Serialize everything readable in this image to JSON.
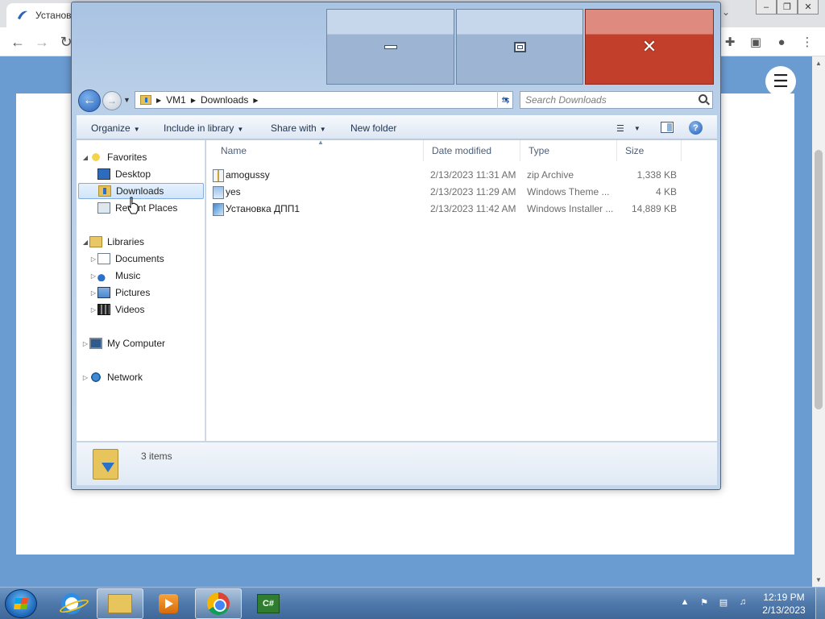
{
  "browser": {
    "tab_title": "Установ",
    "toolbar_icons": [
      "back-icon",
      "forward-icon",
      "reload-icon",
      "extensions-icon",
      "side-panel-icon",
      "profile-icon",
      "menu-icon"
    ],
    "accent_color": "#6a9bd1"
  },
  "explorer": {
    "breadcrumbs": [
      "VM1",
      "Downloads"
    ],
    "search_placeholder": "Search Downloads",
    "commands": {
      "organize": "Organize",
      "include_in_library": "Include in library",
      "share_with": "Share with",
      "new_folder": "New folder"
    },
    "nav": {
      "favorites": "Favorites",
      "desktop": "Desktop",
      "downloads": "Downloads",
      "recent_places": "Recent Places",
      "libraries": "Libraries",
      "documents": "Documents",
      "music": "Music",
      "pictures": "Pictures",
      "videos": "Videos",
      "my_computer": "My Computer",
      "network": "Network"
    },
    "columns": {
      "name": "Name",
      "date_modified": "Date modified",
      "type": "Type",
      "size": "Size"
    },
    "files": [
      {
        "name": "amogussy",
        "date": "2/13/2023 11:31 AM",
        "type": "zip Archive",
        "size": "1,338 KB",
        "icon": "zip-icon"
      },
      {
        "name": "yes",
        "date": "2/13/2023 11:29 AM",
        "type": "Windows Theme ...",
        "size": "4 KB",
        "icon": "theme-file-icon"
      },
      {
        "name": "Установка ДПП1",
        "date": "2/13/2023 11:42 AM",
        "type": "Windows Installer ...",
        "size": "14,889 KB",
        "icon": "installer-icon"
      }
    ],
    "item_count": "3 items"
  },
  "taskbar": {
    "csharp_label": "C#",
    "time": "12:19 PM",
    "date": "2/13/2023"
  }
}
